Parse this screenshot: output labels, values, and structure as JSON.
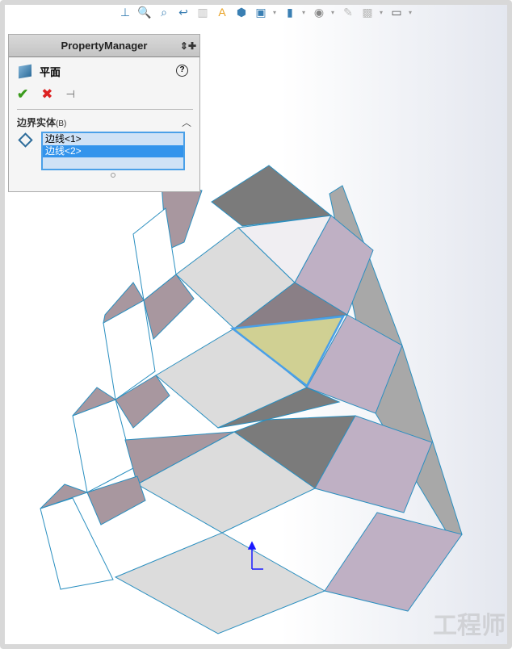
{
  "toolbar": {
    "icons": [
      "view-orientation-icon",
      "zoom-to-fit-icon",
      "zoom-to-area-icon",
      "previous-view-icon",
      "section-view-icon",
      "dynamic-annotation-icon",
      "view-orientation-cube-icon",
      "display-style-icon",
      "hide-show-icon",
      "edit-appearance-icon",
      "apply-scene-icon",
      "view-settings-icon"
    ]
  },
  "property_manager": {
    "title": "PropertyManager",
    "feature": "平面",
    "section_title": "边界实体",
    "section_shortcut": "(B)",
    "list": [
      {
        "label": "边线<1>",
        "selected": false
      },
      {
        "label": "边线<2>",
        "selected": true
      }
    ]
  },
  "watermark": "工程师",
  "colors": {
    "accent": "#3394ec",
    "purple": "#bfb0c4",
    "dark": "#7b7b7b",
    "light": "#dcdcdc",
    "edge": "#2a8fc0"
  }
}
